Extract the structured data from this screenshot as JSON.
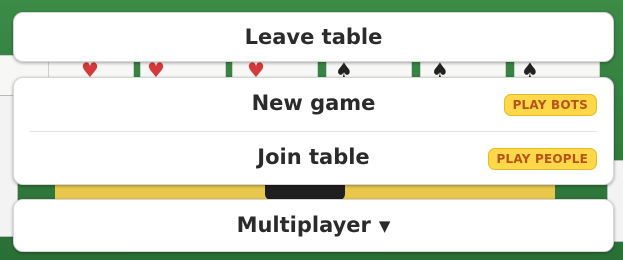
{
  "menu": {
    "leave_label": "Leave table",
    "new_game_label": "New game",
    "new_game_badge": "PLAY BOTS",
    "join_table_label": "Join table",
    "join_table_badge": "PLAY PEOPLE",
    "mode_label": "Multiplayer",
    "mode_caret": "▼"
  },
  "table": {
    "visible_suits": [
      "♥",
      "♥",
      "♥",
      "♠",
      "♠",
      "♠"
    ]
  },
  "colors": {
    "felt": "#2f7a3d",
    "badge_bg": "#ffd84a",
    "badge_text": "#b8531a"
  }
}
